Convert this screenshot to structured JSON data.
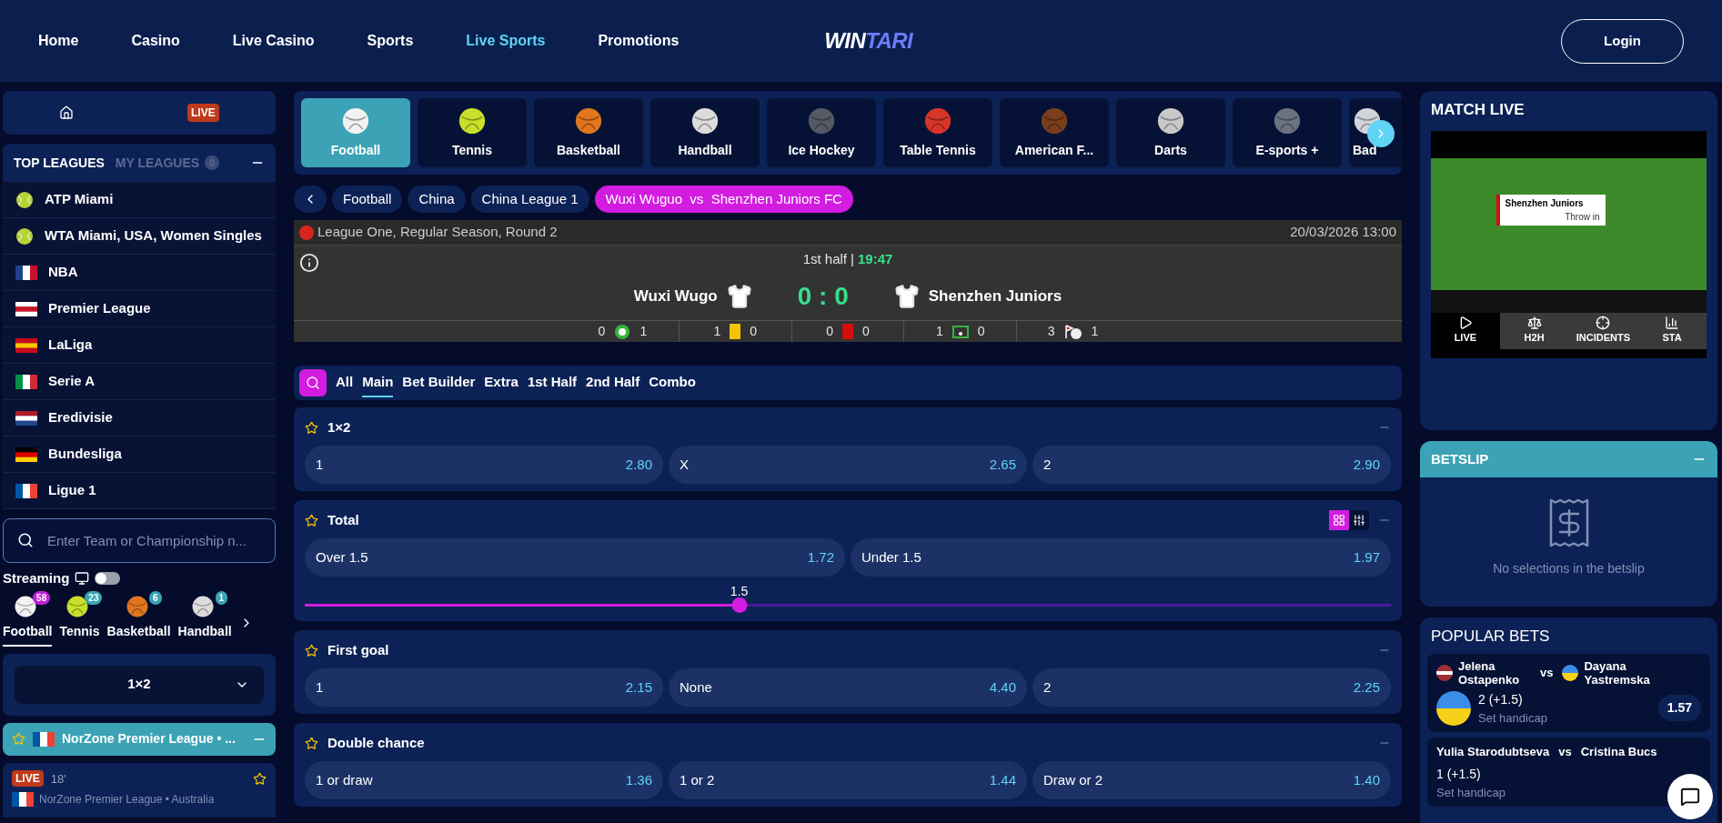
{
  "header": {
    "nav": [
      {
        "label": "Home",
        "selected": false
      },
      {
        "label": "Casino",
        "selected": false
      },
      {
        "label": "Live Casino",
        "selected": false
      },
      {
        "label": "Sports",
        "selected": false
      },
      {
        "label": "Live Sports",
        "selected": true
      },
      {
        "label": "Promotions",
        "selected": false
      }
    ],
    "logo": [
      "WIN",
      "TARI"
    ],
    "login": "Login"
  },
  "sidebar": {
    "live_badge": "LIVE",
    "league_tabs": [
      {
        "label": "TOP LEAGUES",
        "selected": true
      },
      {
        "label": "MY LEAGUES",
        "selected": false,
        "count": "0"
      }
    ],
    "leagues": [
      "ATP Miami",
      "WTA Miami, USA, Women Singles",
      "NBA",
      "Premier League",
      "LaLiga",
      "Serie A",
      "Eredivisie",
      "Bundesliga",
      "Ligue 1"
    ],
    "search": {
      "placeholder": "Enter Team or Championship n..."
    },
    "streaming": {
      "label": "Streaming",
      "on": false
    },
    "sports": [
      {
        "label": "Football",
        "count": "58",
        "selected": true
      },
      {
        "label": "Tennis",
        "count": "23",
        "selected": false
      },
      {
        "label": "Basketball",
        "count": "6",
        "selected": false
      },
      {
        "label": "Handball",
        "count": "1",
        "selected": false
      }
    ],
    "market_select": "1×2",
    "league_group": {
      "title": "NorZone Premier League • ...",
      "expanded": true
    },
    "live_match": {
      "badge": "LIVE",
      "minute": "18'",
      "league": "NorZone Premier League • Australia"
    }
  },
  "sports_bar": [
    {
      "label": "Football",
      "selected": true
    },
    {
      "label": "Tennis",
      "selected": false
    },
    {
      "label": "Basketball",
      "selected": false
    },
    {
      "label": "Handball",
      "selected": false
    },
    {
      "label": "Ice Hockey",
      "selected": false
    },
    {
      "label": "Table Tennis",
      "selected": false
    },
    {
      "label": "American F...",
      "selected": false
    },
    {
      "label": "Darts",
      "selected": false
    },
    {
      "label": "E-sports +",
      "selected": false
    },
    {
      "label": "Bad",
      "selected": false
    }
  ],
  "breadcrumbs": [
    "Football",
    "China",
    "China League 1"
  ],
  "current_match": "Wuxi Wuguo  vs  Shenzhen Juniors FC",
  "match": {
    "league": "League One, Regular Season, Round 2",
    "datetime": "20/03/2026 13:00",
    "period": "1st half",
    "separator": "|",
    "clock": "19:47",
    "home": "Wuxi Wugo",
    "away": "Shenzhen Juniors",
    "score": "0 : 0",
    "stats": [
      {
        "home": "0",
        "away": "1"
      },
      {
        "home": "1",
        "away": "0"
      },
      {
        "home": "0",
        "away": "0"
      },
      {
        "home": "1",
        "away": "0"
      },
      {
        "home": "3",
        "away": "1"
      }
    ]
  },
  "market_tabs": [
    {
      "label": "All",
      "selected": false
    },
    {
      "label": "Main",
      "selected": true
    },
    {
      "label": "Bet Builder",
      "selected": false
    },
    {
      "label": "Extra",
      "selected": false
    },
    {
      "label": "1st Half",
      "selected": false
    },
    {
      "label": "2nd Half",
      "selected": false
    },
    {
      "label": "Combo",
      "selected": false
    }
  ],
  "markets": [
    {
      "title": "1×2",
      "odds": [
        {
          "label": "1",
          "price": "2.80"
        },
        {
          "label": "X",
          "price": "2.65"
        },
        {
          "label": "2",
          "price": "2.90"
        }
      ]
    },
    {
      "title": "Total",
      "view_toggle": true,
      "odds": [
        {
          "label": "Over 1.5",
          "price": "1.72"
        },
        {
          "label": "Under 1.5",
          "price": "1.97"
        }
      ],
      "slider": {
        "value": "1.5",
        "level": 0.4
      }
    },
    {
      "title": "First goal",
      "odds": [
        {
          "label": "1",
          "price": "2.15"
        },
        {
          "label": "None",
          "price": "4.40"
        },
        {
          "label": "2",
          "price": "2.25"
        }
      ]
    },
    {
      "title": "Double chance",
      "odds": [
        {
          "label": "1 or draw",
          "price": "1.36"
        },
        {
          "label": "1 or 2",
          "price": "1.44"
        },
        {
          "label": "Draw or 2",
          "price": "1.40"
        }
      ]
    }
  ],
  "match_live": {
    "title": "MATCH LIVE",
    "tracker": {
      "team": "Shenzhen Juniors",
      "event": "Throw in"
    },
    "tabs": [
      {
        "label": "LIVE",
        "selected": true
      },
      {
        "label": "H2H",
        "selected": false
      },
      {
        "label": "INCIDENTS",
        "selected": false
      },
      {
        "label": "STA",
        "selected": false
      }
    ]
  },
  "betslip": {
    "title": "BETSLIP",
    "empty_text": "No selections in the betslip"
  },
  "popular_bets": {
    "title": "POPULAR BETS",
    "items": [
      {
        "home": "Jelena Ostapenko",
        "vs": "vs",
        "away": "Dayana Yastremska",
        "pick": "2 (+1.5)",
        "market": "Set handicap",
        "price": "1.57"
      },
      {
        "home": "Yulia Starodubtseva",
        "vs": "vs",
        "away": "Cristina Bucs",
        "pick": "1 (+1.5)",
        "market": "Set handicap"
      }
    ]
  }
}
